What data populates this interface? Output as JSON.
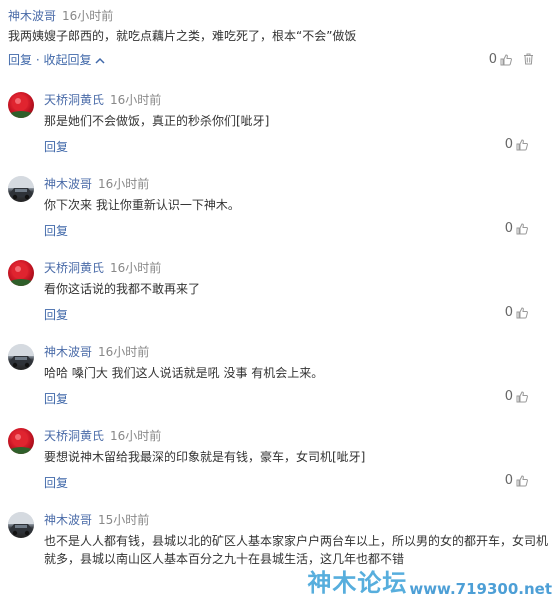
{
  "top_comment": {
    "author": "神木波哥",
    "time": "16小时前",
    "content": "我两姨嫂子郎西的，就吃点藕片之类，难吃死了，根本“不会”做饭",
    "reply_label": "回复",
    "collapse_label": "收起回复",
    "likes": "0"
  },
  "replies": [
    {
      "author": "天桥洞黄氏",
      "time": "16小时前",
      "content": "那是她们不会做饭，真正的秒杀你们[呲牙]",
      "reply_label": "回复",
      "likes": "0",
      "avatar": "red-flower"
    },
    {
      "author": "神木波哥",
      "time": "16小时前",
      "content": "你下次来 我让你重新认识一下神木。",
      "reply_label": "回复",
      "likes": "0",
      "avatar": "car"
    },
    {
      "author": "天桥洞黄氏",
      "time": "16小时前",
      "content": "看你这话说的我都不敢再来了",
      "reply_label": "回复",
      "likes": "0",
      "avatar": "red-flower"
    },
    {
      "author": "神木波哥",
      "time": "16小时前",
      "content": "哈哈 嗓门大 我们这人说话就是吼 没事 有机会上来。",
      "reply_label": "回复",
      "likes": "0",
      "avatar": "car"
    },
    {
      "author": "天桥洞黄氏",
      "time": "16小时前",
      "content": "要想说神木留给我最深的印象就是有钱，豪车，女司机[呲牙]",
      "reply_label": "回复",
      "likes": "0",
      "avatar": "red-flower"
    },
    {
      "author": "神木波哥",
      "time": "15小时前",
      "content": "也不是人人都有钱，县城以北的矿区人基本家家户户两台车以上，所以男的女的都开车，女司机就多，县城以南山区人基本百分之九十在县城生活，这几年也都不错",
      "avatar": "car"
    }
  ],
  "watermark": {
    "logo": "神木论坛",
    "url": "www.719300.net"
  },
  "colors": {
    "author": "#4a6ba8",
    "link": "#4169aa",
    "time": "#888888",
    "text": "#333333"
  }
}
